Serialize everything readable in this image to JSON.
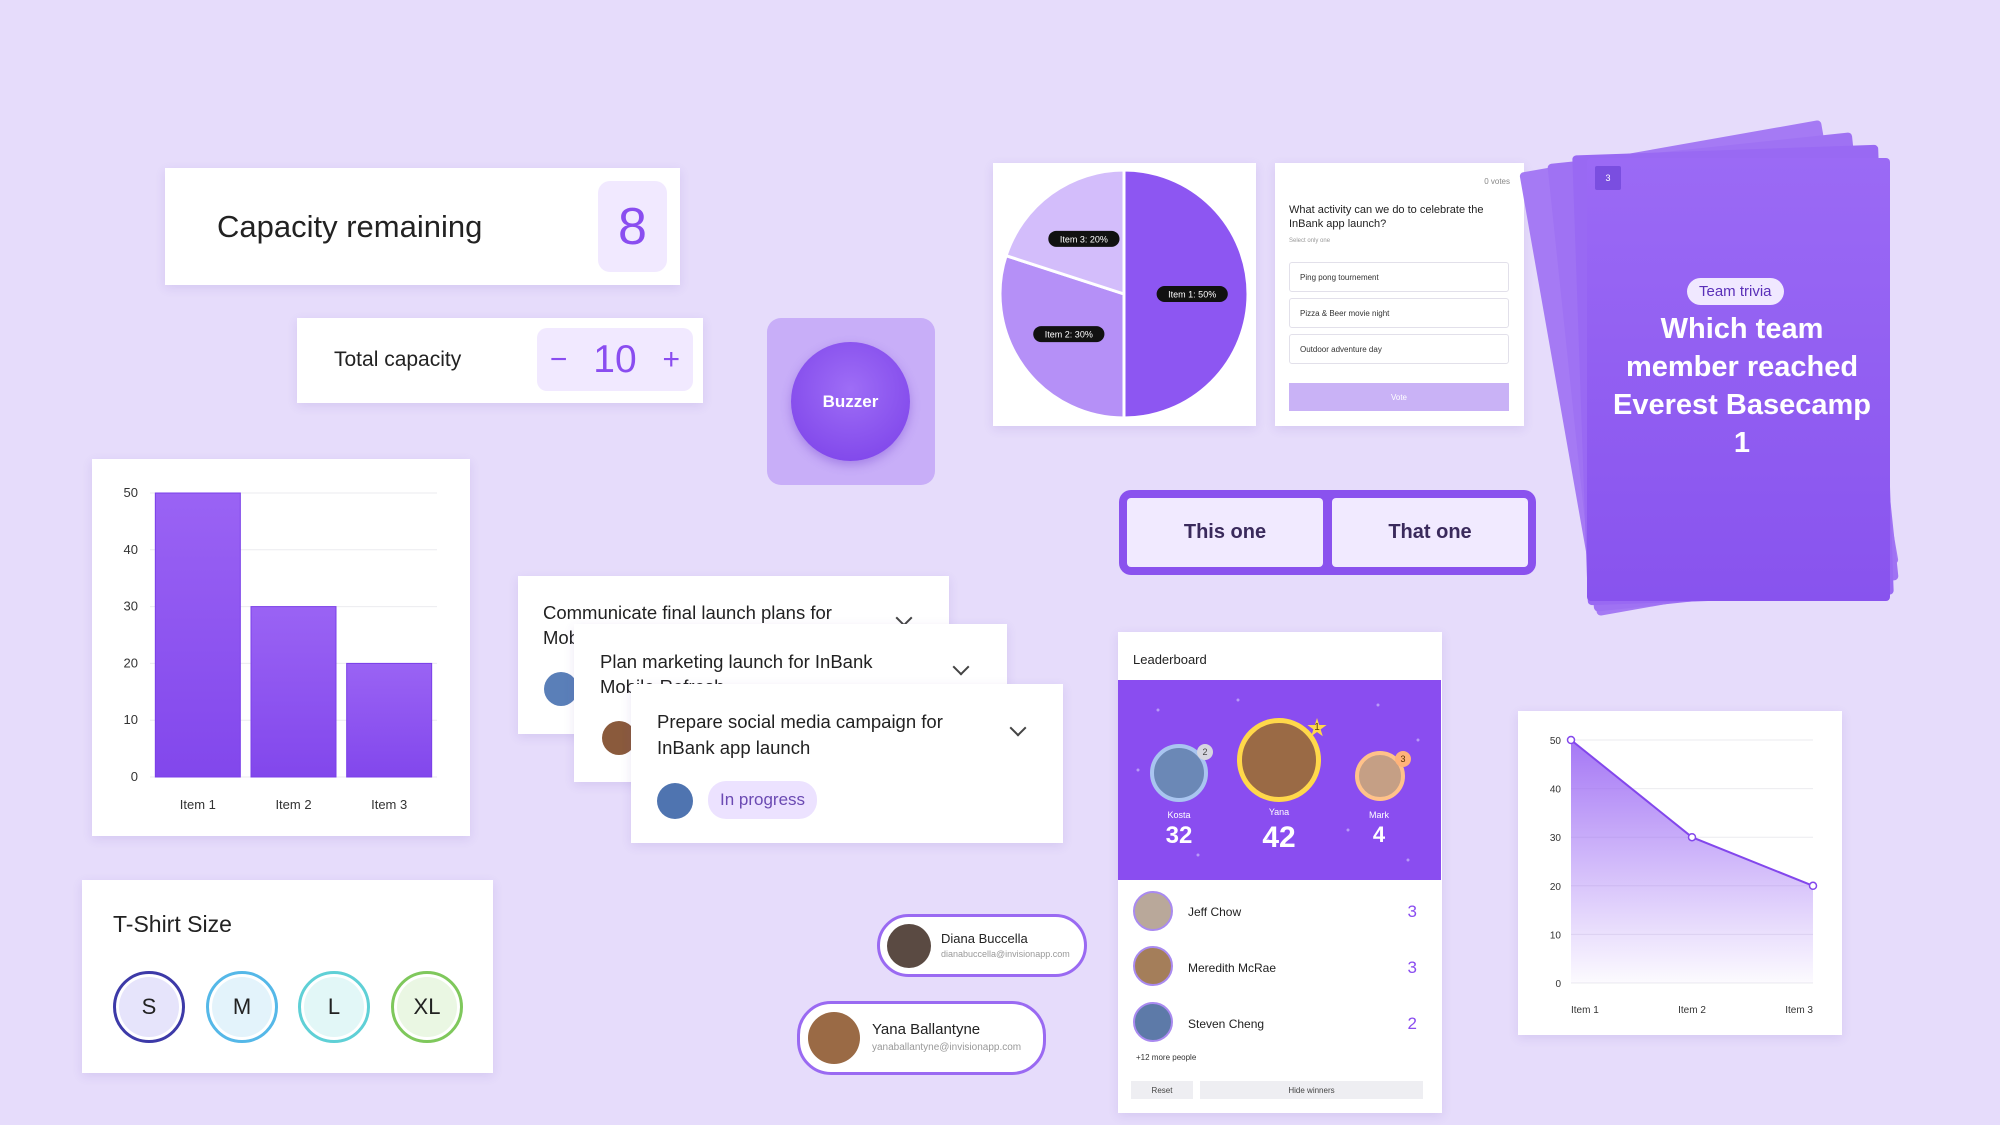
{
  "capacity": {
    "label": "Capacity remaining",
    "value": "8"
  },
  "total": {
    "label": "Total capacity",
    "minus": "−",
    "value": "10",
    "plus": "+"
  },
  "buzzer": {
    "label": "Buzzer"
  },
  "pie": {
    "slices": [
      {
        "label": "Item 1: 50%",
        "value": 50,
        "color": "#8d56f2"
      },
      {
        "label": "Item 2: 30%",
        "value": 30,
        "color": "#b590f7"
      },
      {
        "label": "Item 3: 20%",
        "value": 20,
        "color": "#d3bdfb"
      }
    ]
  },
  "poll": {
    "votes": "0 votes",
    "question": "What activity can we do to celebrate the InBank app launch?",
    "hint": "Select only one",
    "options": [
      "Ping pong tournement",
      "Pizza & Beer movie night",
      "Outdoor adventure day"
    ],
    "vote_label": "Vote"
  },
  "trivia": {
    "card_number": "3",
    "chip": "Team trivia",
    "question": "Which team member reached Everest Basecamp 1"
  },
  "choice": {
    "a": "This one",
    "b": "That one"
  },
  "bar_chart": {
    "chart_data": {
      "type": "bar",
      "categories": [
        "Item 1",
        "Item 2",
        "Item 3"
      ],
      "values": [
        50,
        30,
        20
      ],
      "ylim": [
        0,
        50
      ],
      "yticks": [
        "0",
        "10",
        "20",
        "30",
        "40",
        "50"
      ],
      "grid": true
    }
  },
  "line_chart": {
    "chart_data": {
      "type": "area",
      "categories": [
        "Item 1",
        "Item 2",
        "Item 3"
      ],
      "values": [
        50,
        30,
        20
      ],
      "ylim": [
        0,
        50
      ],
      "yticks": [
        "0",
        "10",
        "20",
        "30",
        "40",
        "50"
      ],
      "grid": true
    }
  },
  "tasks": {
    "t1": {
      "title": "Communicate final launch plans for Mobile Refresh"
    },
    "t2": {
      "title": "Plan marketing launch for InBank Mobile Refresh"
    },
    "t3": {
      "title_line1": "Prepare social media campaign for",
      "title_line2": "InBank app launch",
      "status": "In progress"
    }
  },
  "leaderboard": {
    "title": "Leaderboard",
    "top": [
      {
        "rank": "2",
        "name": "Kosta",
        "score": "32"
      },
      {
        "rank": "1",
        "name": "Yana",
        "score": "42"
      },
      {
        "rank": "3",
        "name": "Mark",
        "score": "4"
      }
    ],
    "rows": [
      {
        "name": "Jeff Chow",
        "score": "3"
      },
      {
        "name": "Meredith McRae",
        "score": "3"
      },
      {
        "name": "Steven Cheng",
        "score": "2"
      }
    ],
    "more": "+12 more people",
    "reset": "Reset",
    "hide": "Hide winners"
  },
  "tshirt": {
    "title": "T-Shirt Size",
    "sizes": [
      "S",
      "M",
      "L",
      "XL"
    ]
  },
  "contacts": [
    {
      "name": "Diana Buccella",
      "email": "dianabuccella@invisionapp.com"
    },
    {
      "name": "Yana Ballantyne",
      "email": "yanaballantyne@invisionapp.com"
    }
  ]
}
